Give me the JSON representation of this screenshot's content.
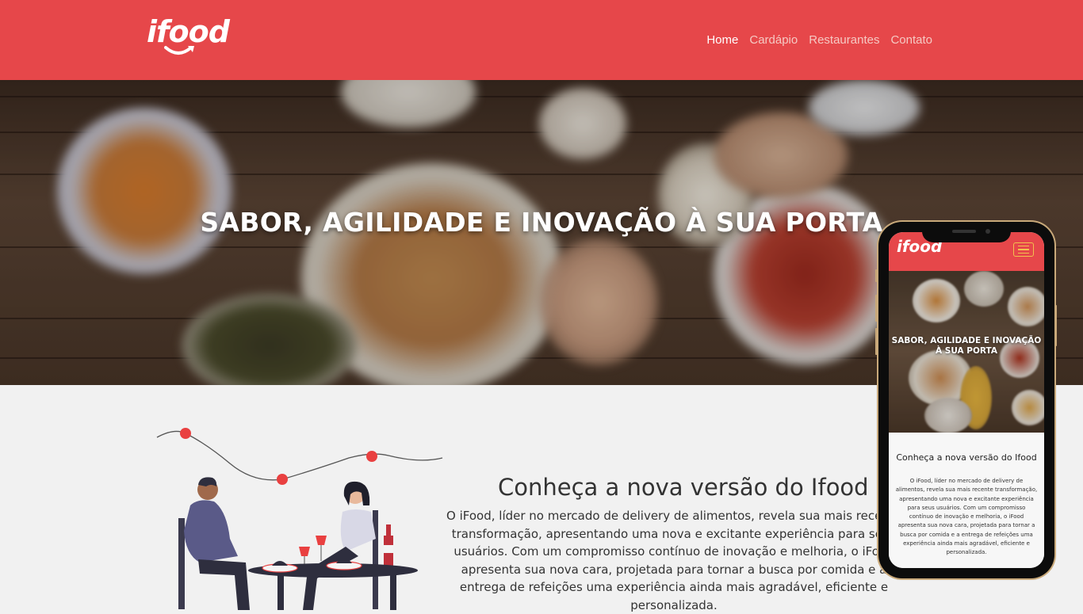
{
  "header": {
    "logo": "ifood",
    "nav": [
      {
        "label": "Home",
        "active": true
      },
      {
        "label": "Cardápio",
        "active": false
      },
      {
        "label": "Restaurantes",
        "active": false
      },
      {
        "label": "Contato",
        "active": false
      }
    ]
  },
  "hero": {
    "title": "SABOR, AGILIDADE E INOVAÇÃO À SUA PORTA"
  },
  "about": {
    "title": "Conheça a nova versão do Ifood",
    "text": "O iFood, líder no mercado de delivery de alimentos, revela sua mais recente transformação, apresentando uma nova e excitante experiência para seus usuários. Com um compromisso contínuo de inovação e melhoria, o iFood apresenta sua nova cara, projetada para tornar a busca por comida e a entrega de refeições uma experiência ainda mais agradável, eficiente e personalizada."
  },
  "mobile": {
    "logo": "ifood",
    "hero_title": "SABOR, AGILIDADE E INOVAÇÃO À SUA PORTA",
    "title": "Conheça a nova versão do Ifood",
    "text": "O iFood, líder no mercado de delivery de alimentos, revela sua mais recente transformação, apresentando uma nova e excitante experiência para seus usuários. Com um compromisso contínuo de inovação e melhoria, o iFood apresenta sua nova cara, projetada para tornar a busca por comida e a entrega de refeições uma experiência ainda mais agradável, eficiente e personalizada."
  },
  "colors": {
    "brand_red": "#e6474a",
    "nav_active": "#ffffff",
    "nav_inactive": "#f5c9c3",
    "page_bg": "#f1f1f1",
    "text": "#333333",
    "burger_accent": "#f2c14e"
  },
  "icons": [
    "ifood-logo-icon",
    "hamburger-menu-icon",
    "dinner-couple-illustration"
  ]
}
